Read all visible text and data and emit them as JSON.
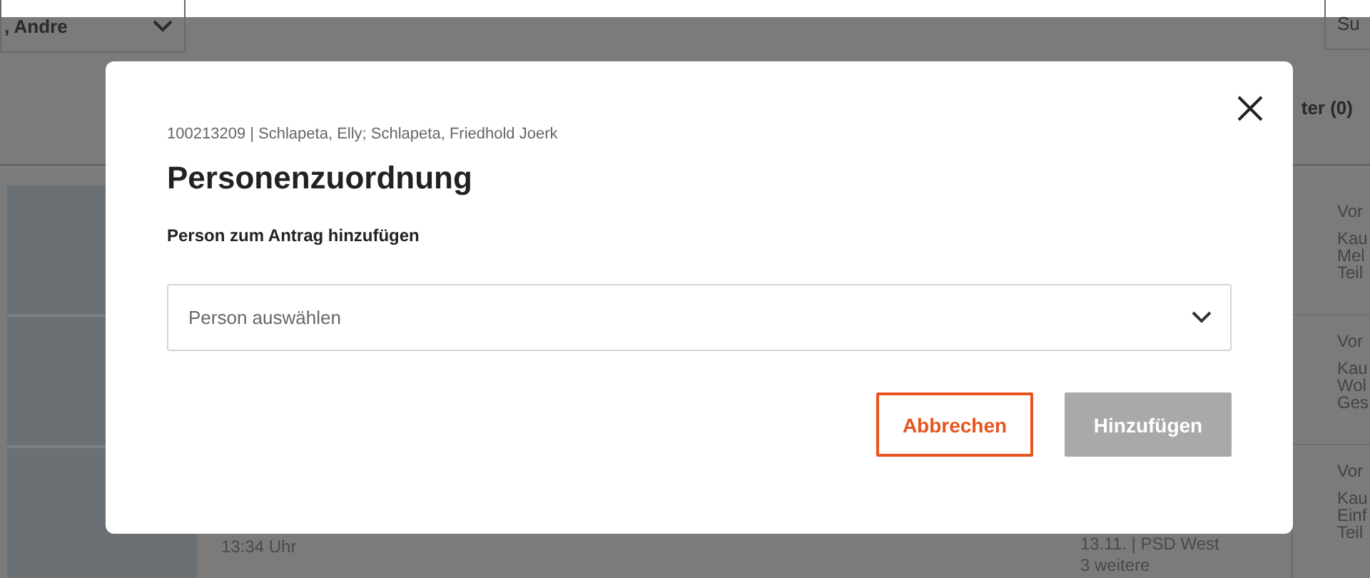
{
  "background": {
    "user_select": {
      "value": ", Andre"
    },
    "search_button": "Su",
    "filter_tab": "ter (0)",
    "rows": [
      {
        "side_title": "Vor",
        "side_lines": [
          "Kau",
          "Mel",
          "Teil"
        ]
      },
      {
        "side_title": "Vor",
        "side_lines": [
          "Kau",
          "Wol",
          "Ges"
        ]
      },
      {
        "time": "13:34 Uhr",
        "date": "13.11. | PSD West",
        "more": "3 weitere",
        "side_title": "Vor",
        "side_lines": [
          "Kau",
          "Einf",
          "Teil"
        ]
      }
    ]
  },
  "dialog": {
    "subtitle": "100213209 | Schlapeta, Elly; Schlapeta, Friedhold Joerk",
    "title": "Personenzuordnung",
    "field_label": "Person zum Antrag hinzufügen",
    "select": {
      "placeholder": "Person auswählen"
    },
    "buttons": [
      {
        "label": "Abbrechen",
        "kind": "secondary",
        "disabled": false
      },
      {
        "label": "Hinzufügen",
        "kind": "primary",
        "disabled": true
      }
    ]
  }
}
